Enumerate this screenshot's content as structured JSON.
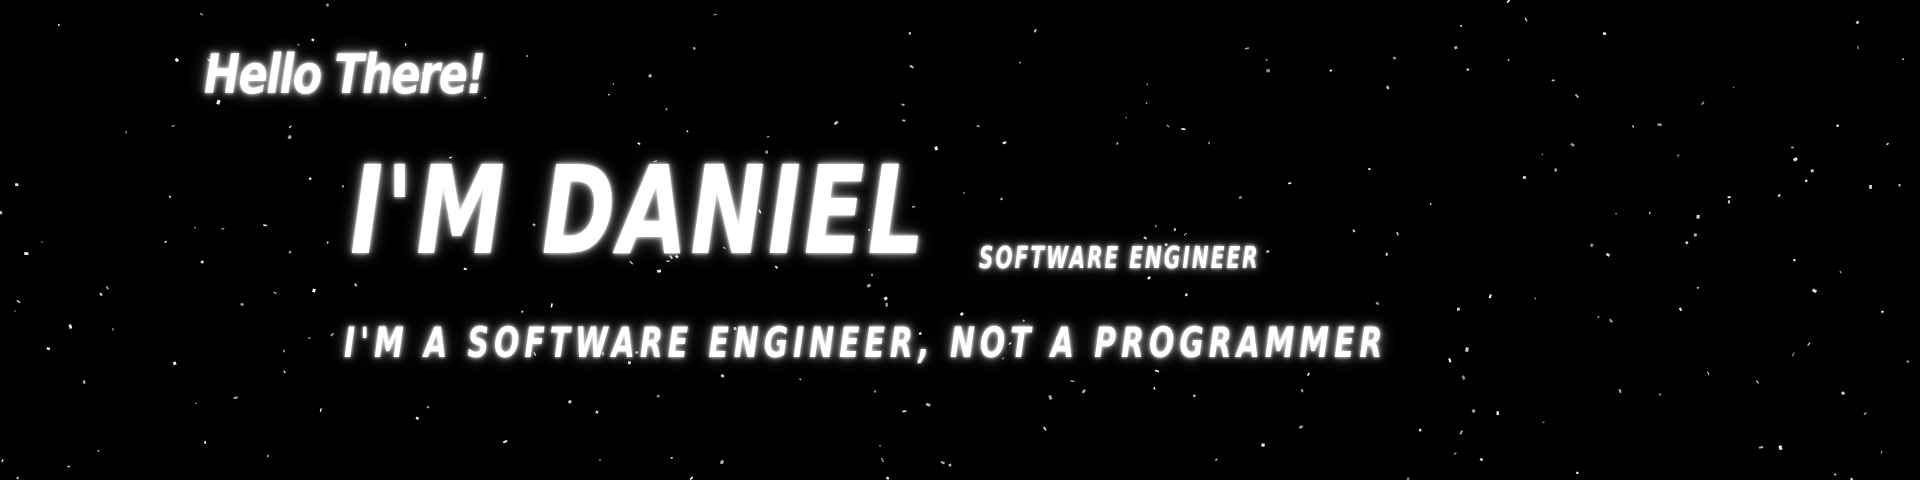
{
  "hero": {
    "greeting": "Hello There!",
    "name": "I'M DANIEL",
    "role": "SOFTWARE ENGINEER",
    "tagline": "I'M A SOFTWARE ENGINEER, NOT A PROGRAMMER"
  },
  "colors": {
    "background": "#000000",
    "text": "#ffffff",
    "stars": "#ffffff"
  }
}
